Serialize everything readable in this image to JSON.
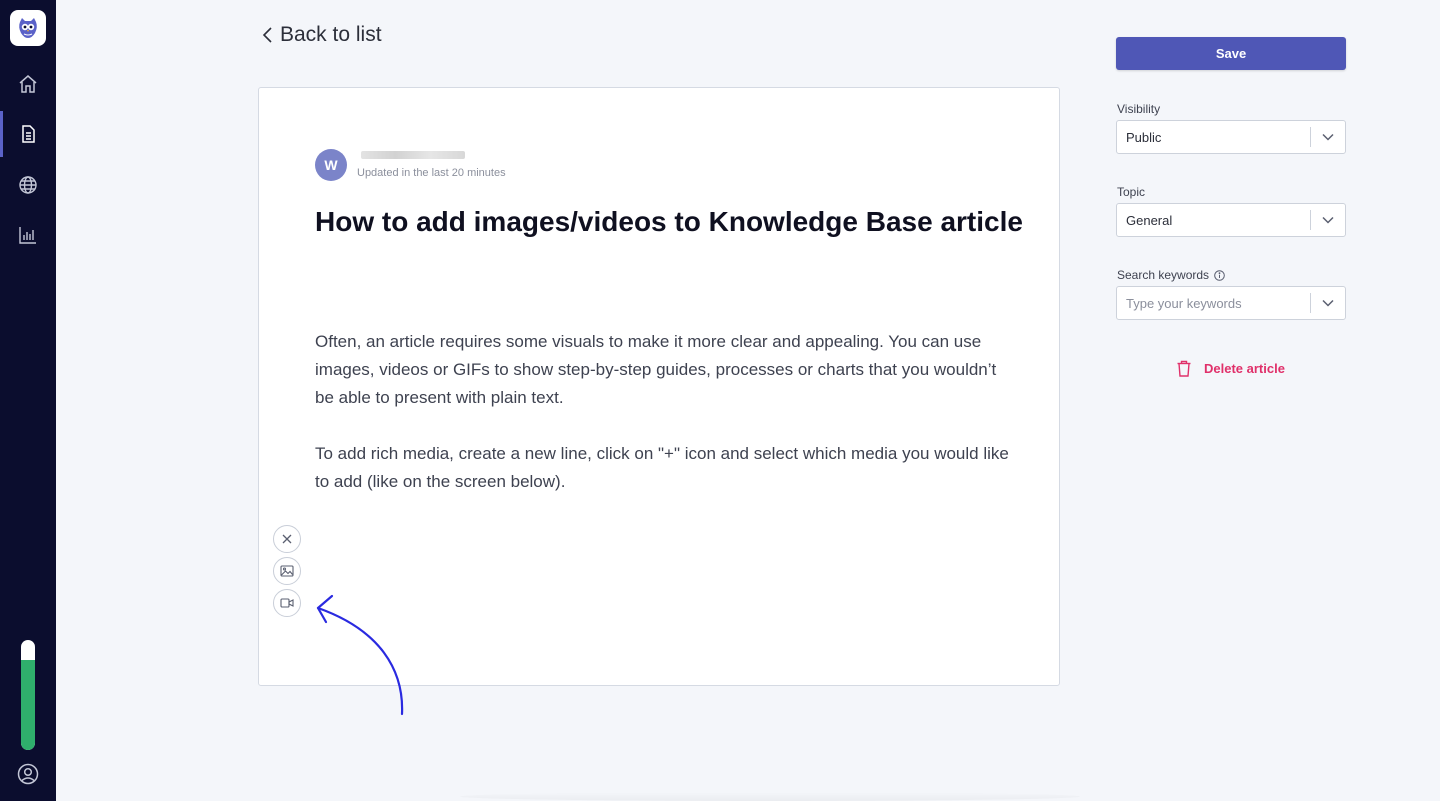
{
  "sidebar": {
    "logo_icon": "owl-logo-icon",
    "items": [
      {
        "name": "home",
        "icon": "home-icon"
      },
      {
        "name": "articles",
        "icon": "document-icon",
        "active": true
      },
      {
        "name": "web",
        "icon": "globe-icon"
      },
      {
        "name": "reports",
        "icon": "bar-chart-icon"
      }
    ],
    "usage_meter_fraction": 0.82,
    "profile_icon": "user-icon"
  },
  "back_link": {
    "label": "Back to list"
  },
  "article": {
    "author_initial": "W",
    "updated": "Updated in the last 20 minutes",
    "title": "How to add images/videos to Knowledge Base article",
    "paragraphs": [
      "Often, an article requires some visuals to make it more clear and appealing. You can use images, videos or GIFs to show step-by-step guides, processes or charts that you wouldn’t be able to present with plain text.",
      "To add rich media, create a new line, click on \"+\" icon and select which media you would like to add (like on the screen below)."
    ],
    "media_buttons": [
      "close-icon",
      "image-icon",
      "video-icon"
    ]
  },
  "panel": {
    "save_label": "Save",
    "visibility": {
      "label": "Visibility",
      "value": "Public"
    },
    "topic": {
      "label": "Topic",
      "value": "General"
    },
    "keywords": {
      "label": "Search keywords",
      "placeholder": "Type your keywords"
    },
    "delete_label": "Delete article"
  },
  "colors": {
    "sidebar_bg": "#0b0d2e",
    "accent": "#4f57b6",
    "danger": "#e0306a",
    "meter": "#2fae6c",
    "arrow": "#2a2ae0"
  }
}
